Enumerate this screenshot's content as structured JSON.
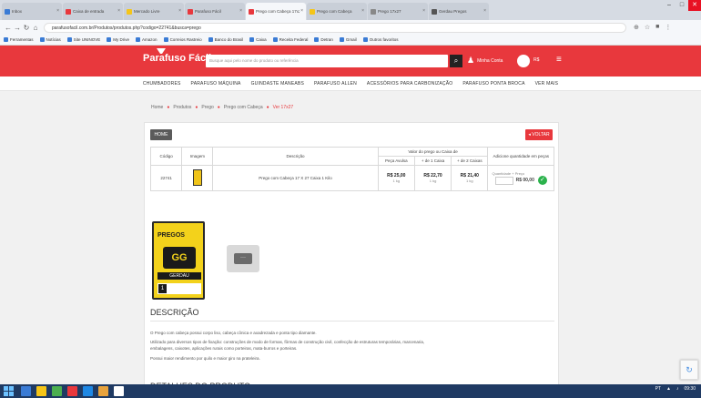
{
  "browser": {
    "tabs": [
      {
        "label": "Inbox",
        "color": "#3a7bd5"
      },
      {
        "label": "Caixa de entrada",
        "color": "#e8383d"
      },
      {
        "label": "Mercado Livre",
        "color": "#f5c518"
      },
      {
        "label": "Parafuso Fácil",
        "color": "#e8383d"
      },
      {
        "label": "Prego com Cabeça 17x27",
        "color": "#e8383d",
        "active": true
      },
      {
        "label": "Prego com Cabeça",
        "color": "#f5c518"
      },
      {
        "label": "Prego 17x27",
        "color": "#888888"
      },
      {
        "label": "Gerdau Pregos",
        "color": "#555555"
      }
    ],
    "url": "parafusofacil.com.br/Produtos/produtos.php?codigo=22741&busca=prego",
    "bookmarks": [
      "Ferramentas",
      "Notícias",
      "Site UNINOVE",
      "My Drive",
      "Amazon",
      "Correios Rastreio",
      "Banco do Brasil",
      "Caixa",
      "Receita Federal",
      "Detran",
      "Gmail",
      "Outros favoritos"
    ]
  },
  "header": {
    "logo": "Parafuso Fácil",
    "search_placeholder": "Busque aqui pelo nome do produto ou referência",
    "account_label": "Minha Conta",
    "cart_count": "R$"
  },
  "catnav": [
    "CHUMBADORES",
    "PARAFUSO MÁQUINA",
    "GUINDASTE MANEABS",
    "PARAFUSO ALLEN",
    "ACESSÓRIOS PARA CARBONIZAÇÃO",
    "PARAFUSO PONTA BROCA",
    "VER MAIS"
  ],
  "breadcrumb": [
    "Home",
    "Produtos",
    "Prego",
    "Prego com Cabeça",
    "Ver 17x27"
  ],
  "buttons": {
    "home": "HOME",
    "back": "◂ VOLTAR"
  },
  "table": {
    "headers": {
      "code": "Código",
      "image": "Imagem",
      "desc": "Descrição",
      "price_group": "Valor do prego ou Caixa de",
      "price_cols": [
        "Peça Avulsa",
        "+ de 1 Caixa",
        "+ de 2 Caixas"
      ],
      "qty": "Adicione quantidade em peças"
    },
    "row": {
      "code": "22741",
      "desc": "Prego com Cabeça 17 X 27 Caixa 1 Kilo",
      "prices": [
        {
          "value": "R$ 25,00",
          "unit": "1 kg"
        },
        {
          "value": "R$ 22,70",
          "unit": "1 kg"
        },
        {
          "value": "R$ 21,40",
          "unit": "1 kg"
        }
      ],
      "qty_label": "Quantidade + Preço",
      "qty_total": "R$ 00,00"
    }
  },
  "gallery": {
    "brand": "PREGOS",
    "logo": "GG",
    "maker": "GERDAU",
    "size": "1",
    "more": "···"
  },
  "description": {
    "title": "DESCRIÇÃO",
    "lines": [
      "O Prego com cabeça possui corpo liso, cabeça cônica e axadrezada e ponta tipo diamante.",
      "Utilizado para diversos tipos de fixação: construções de modo de formas, fôrmas de construção civil, confecção de estruturas temporárias, marcenaria,",
      "embalagens, caixotes, aplicações rurais como porteiras, mata-burros e porteiras.",
      "Possui maior rendimento por quilo e maior giro na prateleira."
    ]
  },
  "details_title": "DETALHES DO PRODUTO",
  "taskbar": {
    "tray": [
      "PT",
      "▲",
      "♪",
      "09:30"
    ]
  }
}
